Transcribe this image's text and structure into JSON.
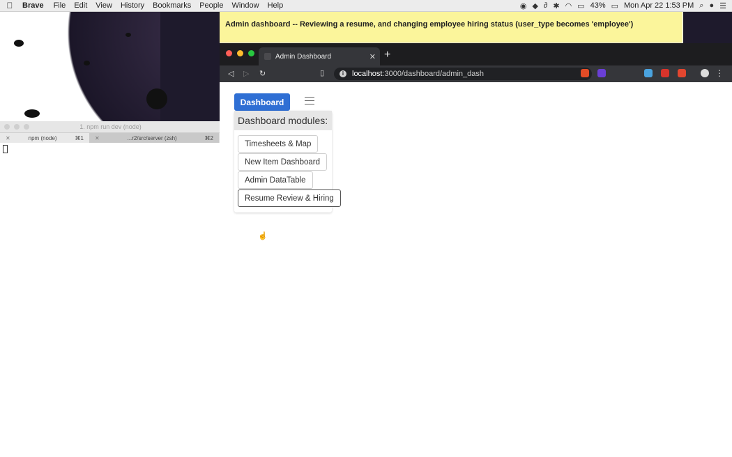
{
  "menubar": {
    "app": "Brave",
    "items": [
      "File",
      "Edit",
      "View",
      "History",
      "Bookmarks",
      "People",
      "Window",
      "Help"
    ],
    "battery": "43%",
    "clock": "Mon Apr 22  1:53 PM"
  },
  "terminal": {
    "title": "1. npm run dev (node)",
    "tabs": [
      {
        "label": "npm (node)",
        "shortcut": "⌘1"
      },
      {
        "label": "...r2/src/server (zsh)",
        "shortcut": "⌘2"
      }
    ]
  },
  "caption": "Admin dashboard -- Reviewing a resume, and changing employee hiring status (user_type becomes 'employee')",
  "browser": {
    "tab_title": "Admin Dashboard",
    "url_host": "localhost",
    "url_path": ":3000/dashboard/admin_dash"
  },
  "page": {
    "dashboard_button": "Dashboard",
    "modules_title": "Dashboard modules:",
    "modules": [
      "Timesheets & Map",
      "New Item Dashboard",
      "Admin DataTable",
      "Resume Review & Hiring"
    ]
  },
  "icons": {
    "apple": "apple-icon",
    "hamburger": "hamburger-menu-icon",
    "pointer": "hand-cursor-icon"
  },
  "colors": {
    "caption_bg": "#fbf59b",
    "dashboard_button": "#2f6fd4",
    "browser_chrome": "#35363a"
  }
}
